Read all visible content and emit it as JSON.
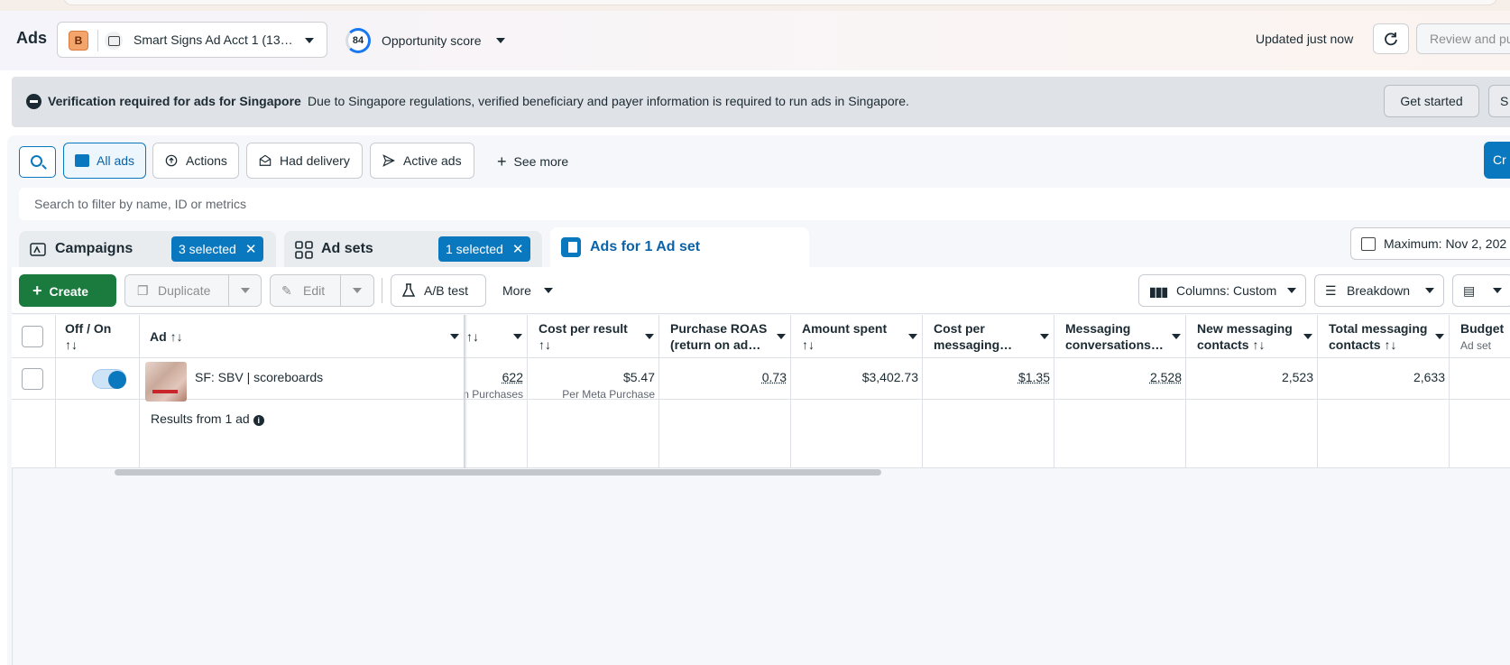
{
  "header": {
    "title": "Ads",
    "account_badge": "B",
    "account_name": "Smart Signs Ad Acct 1 (13…",
    "opportunity_score": "84",
    "opportunity_label": "Opportunity score",
    "updated": "Updated just now",
    "review_label": "Review and pu"
  },
  "banner": {
    "title": "Verification required for ads for Singapore",
    "message": "Due to Singapore regulations, verified beneficiary and payer information is required to run ads in Singapore.",
    "get_started": "Get started",
    "second_button": "S"
  },
  "filters": {
    "chips": [
      "All ads",
      "Actions",
      "Had delivery",
      "Active ads"
    ],
    "see_more": "See more",
    "create_cut": "Cr",
    "search_placeholder": "Search to filter by name, ID or metrics"
  },
  "tabs": {
    "campaigns": "Campaigns",
    "campaigns_badge": "3 selected",
    "adsets": "Ad sets",
    "adsets_badge": "1 selected",
    "ads": "Ads for 1 Ad set",
    "date_range": "Maximum: Nov 2, 202"
  },
  "toolbar": {
    "create": "Create",
    "duplicate": "Duplicate",
    "edit": "Edit",
    "ab_test": "A/B test",
    "more": "More",
    "columns": "Columns: Custom",
    "breakdown": "Breakdown"
  },
  "table": {
    "headers": {
      "off_on": "Off / On",
      "ad": "Ad",
      "cost_per_result": "Cost per result",
      "purchase_roas_1": "Purchase ROAS",
      "purchase_roas_2": "(return on ad…",
      "amount_spent": "Amount spent",
      "cost_per_msg_1": "Cost per",
      "cost_per_msg_2": "messaging…",
      "msg_conv_1": "Messaging",
      "msg_conv_2": "conversations…",
      "new_msg_1": "New messaging",
      "new_msg_2": "contacts",
      "total_msg_1": "Total messaging",
      "total_msg_2": "contacts",
      "budget": "Budget",
      "budget_sub": "Ad set",
      "sort_glyph": "↑↓"
    },
    "row": {
      "ad_name": "SF: SBV | scoreboards",
      "results": "622",
      "results_sub": "n Purchases",
      "cost_per_result": "$5.47",
      "cost_per_result_sub": "Per Meta Purchase",
      "purchase_roas": "0.73",
      "amount_spent": "$3,402.73",
      "cost_per_messaging": "$1.35",
      "messaging_conversations": "2,528",
      "new_messaging_contacts": "2,523",
      "total_messaging_contacts": "2,633"
    },
    "footer": "Results from 1 ad"
  }
}
